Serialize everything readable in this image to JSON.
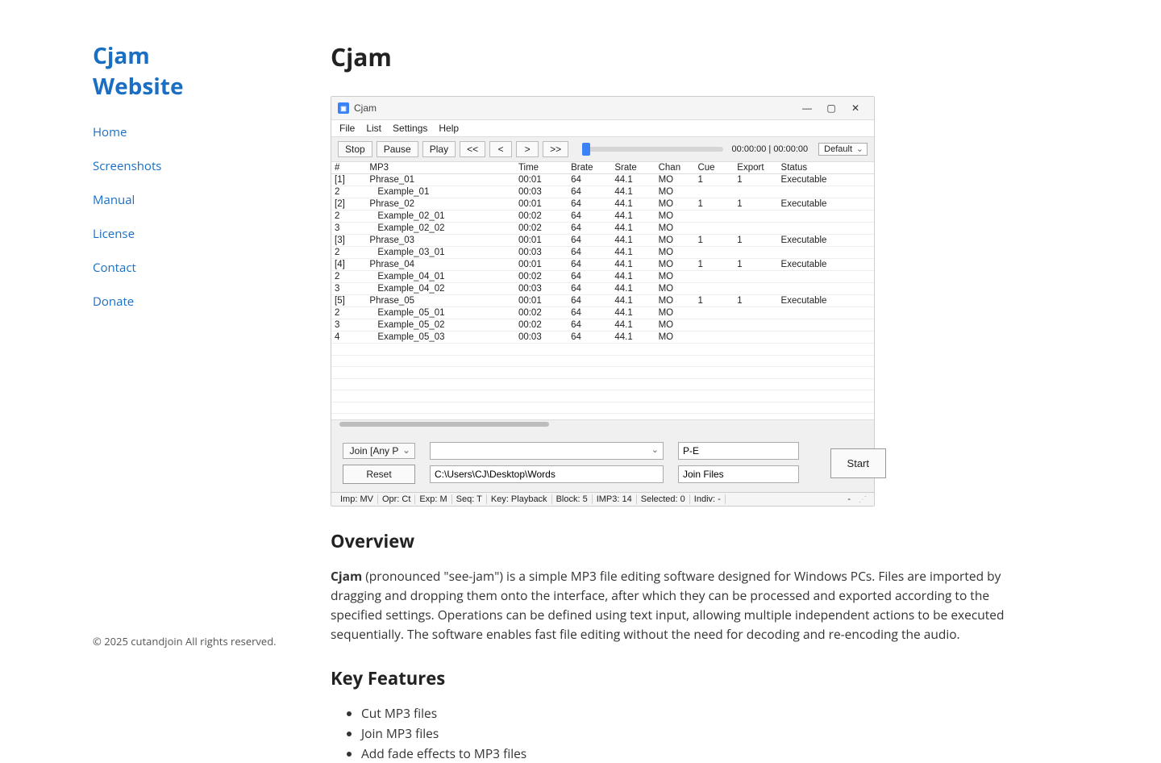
{
  "site": {
    "title": "Cjam Website",
    "nav": [
      "Home",
      "Screenshots",
      "Manual",
      "License",
      "Contact",
      "Donate"
    ],
    "copyright": "© 2025 cutandjoin All rights reserved."
  },
  "page": {
    "h1": "Cjam",
    "overview_h": "Overview",
    "overview_bold": "Cjam",
    "overview_rest": " (pronounced \"see-jam\") is a simple MP3 file editing software designed for Windows PCs. Files are imported by dragging and dropping them onto the interface, after which they can be processed and exported according to the specified settings. Operations can be defined using text input, allowing multiple independent actions to be executed sequentially. The software enables fast file editing without the need for decoding and re-encoding the audio.",
    "features_h": "Key Features",
    "features": [
      "Cut MP3 files",
      "Join MP3 files",
      "Add fade effects to MP3 files"
    ]
  },
  "app": {
    "title": "Cjam",
    "menu": [
      "File",
      "List",
      "Settings",
      "Help"
    ],
    "toolbar": {
      "stop": "Stop",
      "pause": "Pause",
      "play": "Play",
      "rew2": "<<",
      "rew": "<",
      "fwd": ">",
      "fwd2": ">>",
      "time": "00:00:00 | 00:00:00",
      "preset": "Default"
    },
    "cols": [
      "#",
      "MP3",
      "Time",
      "Brate",
      "Srate",
      "Chan",
      "Cue",
      "Export",
      "Status"
    ],
    "rows": [
      {
        "n": "[1]",
        "mp3": "Phrase_01",
        "t": "00:01",
        "b": "64",
        "s": "44.1",
        "c": "MO",
        "cue": "1",
        "exp": "1",
        "st": "Executable"
      },
      {
        "n": "2",
        "mp3": "Example_01",
        "t": "00:03",
        "b": "64",
        "s": "44.1",
        "c": "MO",
        "cue": "",
        "exp": "",
        "st": "",
        "indent": true
      },
      {
        "n": "[2]",
        "mp3": "Phrase_02",
        "t": "00:01",
        "b": "64",
        "s": "44.1",
        "c": "MO",
        "cue": "1",
        "exp": "1",
        "st": "Executable"
      },
      {
        "n": "2",
        "mp3": "Example_02_01",
        "t": "00:02",
        "b": "64",
        "s": "44.1",
        "c": "MO",
        "cue": "",
        "exp": "",
        "st": "",
        "indent": true
      },
      {
        "n": "3",
        "mp3": "Example_02_02",
        "t": "00:02",
        "b": "64",
        "s": "44.1",
        "c": "MO",
        "cue": "",
        "exp": "",
        "st": "",
        "indent": true
      },
      {
        "n": "[3]",
        "mp3": "Phrase_03",
        "t": "00:01",
        "b": "64",
        "s": "44.1",
        "c": "MO",
        "cue": "1",
        "exp": "1",
        "st": "Executable"
      },
      {
        "n": "2",
        "mp3": "Example_03_01",
        "t": "00:03",
        "b": "64",
        "s": "44.1",
        "c": "MO",
        "cue": "",
        "exp": "",
        "st": "",
        "indent": true
      },
      {
        "n": "[4]",
        "mp3": "Phrase_04",
        "t": "00:01",
        "b": "64",
        "s": "44.1",
        "c": "MO",
        "cue": "1",
        "exp": "1",
        "st": "Executable"
      },
      {
        "n": "2",
        "mp3": "Example_04_01",
        "t": "00:02",
        "b": "64",
        "s": "44.1",
        "c": "MO",
        "cue": "",
        "exp": "",
        "st": "",
        "indent": true
      },
      {
        "n": "3",
        "mp3": "Example_04_02",
        "t": "00:03",
        "b": "64",
        "s": "44.1",
        "c": "MO",
        "cue": "",
        "exp": "",
        "st": "",
        "indent": true
      },
      {
        "n": "[5]",
        "mp3": "Phrase_05",
        "t": "00:01",
        "b": "64",
        "s": "44.1",
        "c": "MO",
        "cue": "1",
        "exp": "1",
        "st": "Executable"
      },
      {
        "n": "2",
        "mp3": "Example_05_01",
        "t": "00:02",
        "b": "64",
        "s": "44.1",
        "c": "MO",
        "cue": "",
        "exp": "",
        "st": "",
        "indent": true
      },
      {
        "n": "3",
        "mp3": "Example_05_02",
        "t": "00:02",
        "b": "64",
        "s": "44.1",
        "c": "MO",
        "cue": "",
        "exp": "",
        "st": "",
        "indent": true
      },
      {
        "n": "4",
        "mp3": "Example_05_03",
        "t": "00:03",
        "b": "64",
        "s": "44.1",
        "c": "MO",
        "cue": "",
        "exp": "",
        "st": "",
        "indent": true
      }
    ],
    "bottom": {
      "join_sel": "Join [Any P",
      "reset": "Reset",
      "path": "C:\\Users\\CJ\\Desktop\\Words",
      "pe": "P-E",
      "joinfiles": "Join Files",
      "start": "Start"
    },
    "status": {
      "imp": "Imp: MV",
      "opr": "Opr: Ct",
      "exp": "Exp: M",
      "seq": "Seq: T",
      "key": "Key: Playback",
      "block": "Block: 5",
      "imp3": "IMP3: 14",
      "sel": "Selected: 0",
      "indiv": "Indiv: -",
      "dash": "-"
    }
  }
}
